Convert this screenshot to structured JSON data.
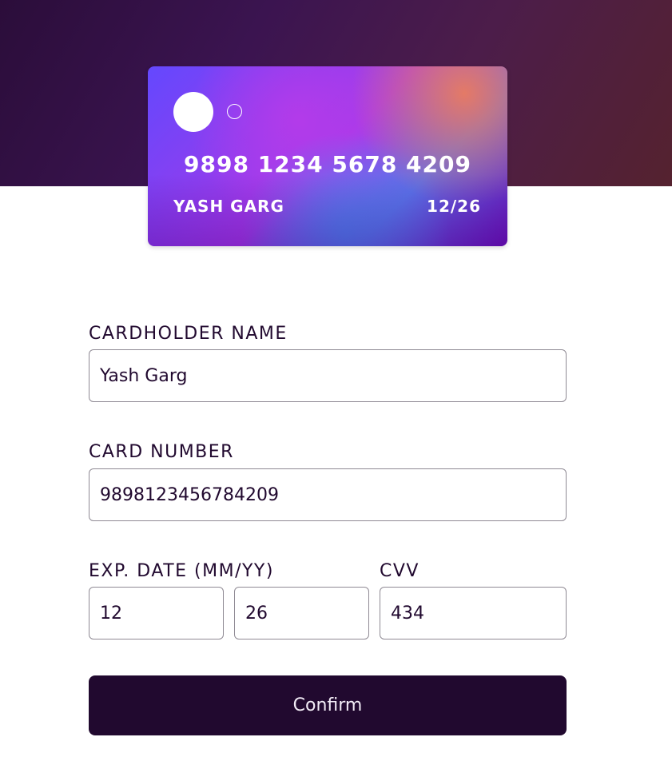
{
  "card_preview": {
    "number": "9898 1234 5678 4209",
    "holder": "YASH GARG",
    "expiry": "12/26"
  },
  "form": {
    "cardholder_name": {
      "label": "CARDHOLDER NAME",
      "value": "Yash Garg"
    },
    "card_number": {
      "label": "CARD NUMBER",
      "value": "9898123456784209"
    },
    "exp_date": {
      "label": "EXP. DATE (MM/YY)",
      "month_value": "12",
      "year_value": "26"
    },
    "cvv": {
      "label": "CVV",
      "value": "434"
    },
    "confirm_label": "Confirm"
  },
  "colors": {
    "primary_dark": "#21092f",
    "input_border": "#8f8a94",
    "hero_background": "#3b1450"
  }
}
